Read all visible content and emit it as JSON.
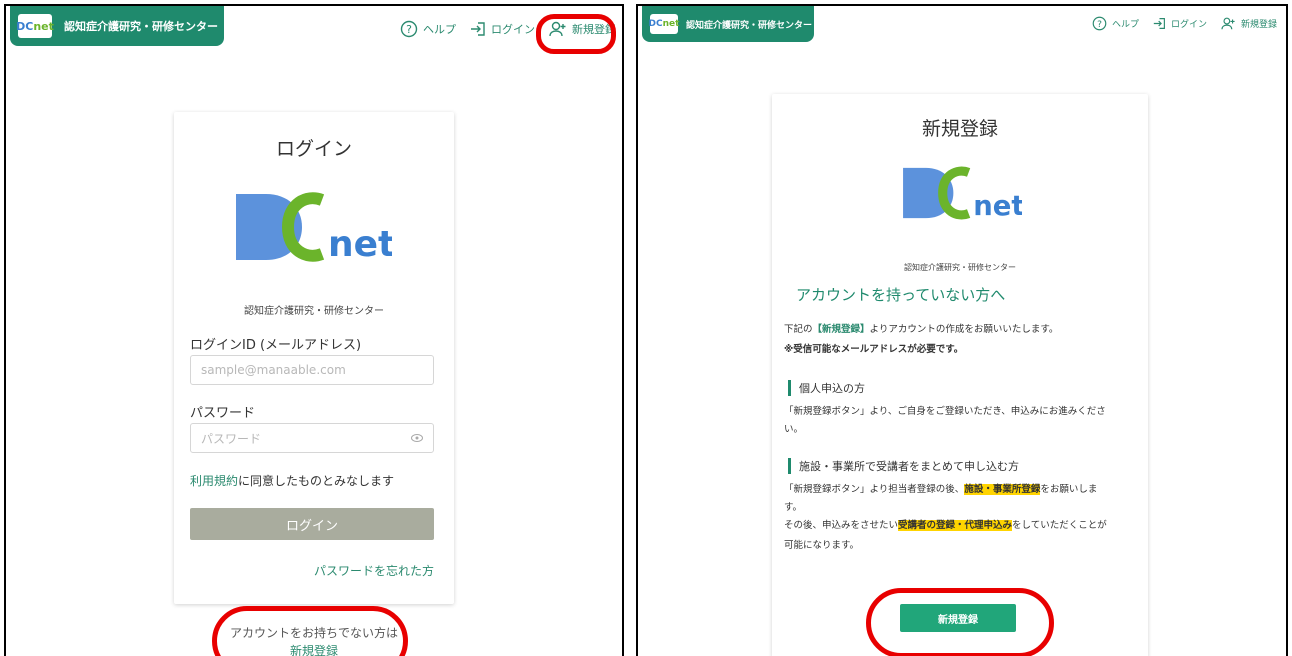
{
  "brand": {
    "logo_text": "DC",
    "logo_suffix": "net",
    "name": "認知症介護研究・研修センター"
  },
  "nav": {
    "help": "ヘルプ",
    "login": "ログイン",
    "register": "新規登録"
  },
  "login_card": {
    "title": "ログイン",
    "org": "認知症介護研究・研修センター",
    "id_label": "ログインID (メールアドレス)",
    "id_placeholder": "sample@manaable.com",
    "pw_label": "パスワード",
    "pw_placeholder": "パスワード",
    "terms_link": "利用規約",
    "terms_rest": "に同意したものとみなします",
    "login_button": "ログイン",
    "forgot": "パスワードを忘れた方",
    "no_account": "アカウントをお持ちでない方は",
    "register_link": "新規登録"
  },
  "register_card": {
    "title": "新規登録",
    "org": "認知症介護研究・研修センター",
    "heading": "アカウントを持っていない方へ",
    "intro_pre": "下記の",
    "intro_bold": "【新規登録】",
    "intro_post": "よりアカウントの作成をお願いいたします。",
    "note": "※受信可能なメールアドレスが必要です。",
    "section1_title": "個人申込の方",
    "section1_line1": "「新規登録ボタン」より、ご自身をご登録いただき、申込みにお進みくださ",
    "section1_line2": "い。",
    "section2_title": "施設・事業所で受講者をまとめて申し込む方",
    "section2_l1_pre": "「新規登録ボタン」より担当者登録の後、",
    "section2_l1_hl": "施設・事業所登録",
    "section2_l1_post": "をお願いしま",
    "section2_l2": "す。",
    "section2_l3_pre": "その後、申込みをさせたい",
    "section2_l3_hl": "受講者の登録・代理申込み",
    "section2_l3_post": "をしていただくことが",
    "section2_l4": "可能になります。",
    "register_button": "新規登録"
  },
  "colors": {
    "brand_green": "#1f8a6d",
    "highlight": "#ffd400",
    "annotation_red": "#e80000",
    "disabled_button": "#a9ac9e"
  }
}
